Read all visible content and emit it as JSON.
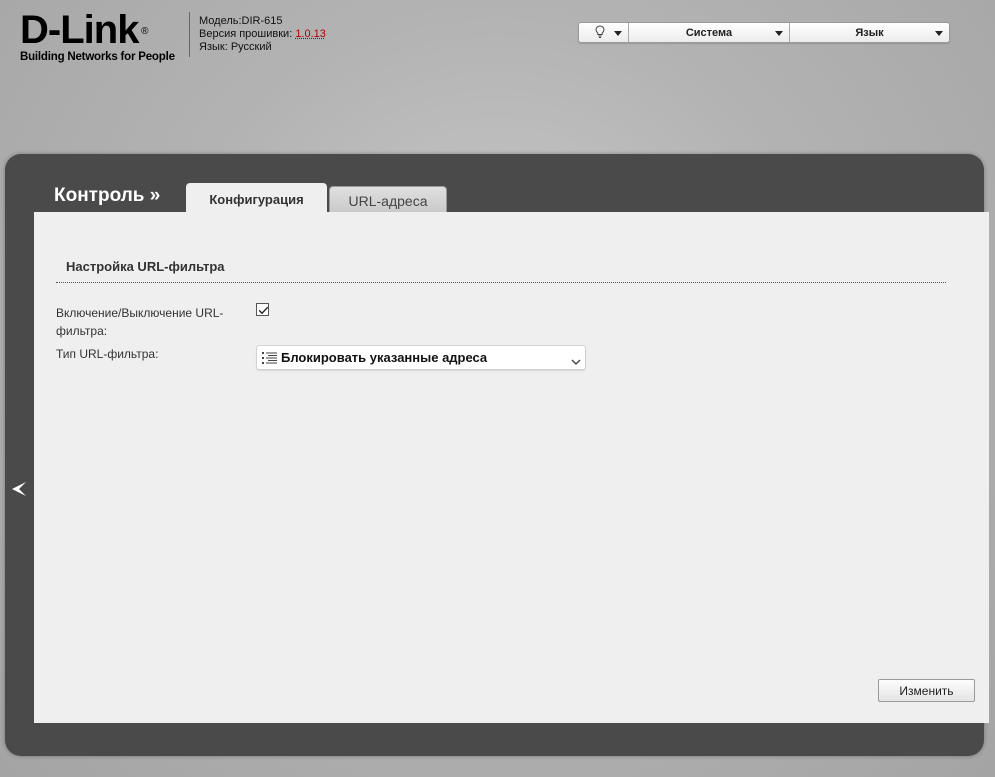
{
  "header": {
    "logo_text": "D-Link",
    "logo_registered": "®",
    "logo_tagline": "Building Networks for People",
    "model_line": "Модель:DIR-615",
    "firmware_label": "Версия прошивки: ",
    "firmware_version": "1.0.13",
    "language_line": "Язык: Русский"
  },
  "topbar": {
    "hint_icon": "lightbulb-icon",
    "system_label": "Система",
    "language_label": "Язык"
  },
  "page": {
    "section_title": "Контроль »",
    "tabs": [
      {
        "label": "Конфигурация",
        "active": true
      },
      {
        "label": "URL-адреса",
        "active": false
      }
    ]
  },
  "form": {
    "group_title": "Настройка URL-фильтра",
    "enable_label": "Включение/Выключение URL-фильтра:",
    "enable_checked": true,
    "type_label": "Тип URL-фильтра:",
    "type_value": "Блокировать указанные адреса",
    "type_icon": "list-icon"
  },
  "actions": {
    "change_label": "Изменить"
  },
  "colors": {
    "frame": "#4a4a4a",
    "content_bg": "#efefef",
    "firmware_link": "#b00000"
  }
}
